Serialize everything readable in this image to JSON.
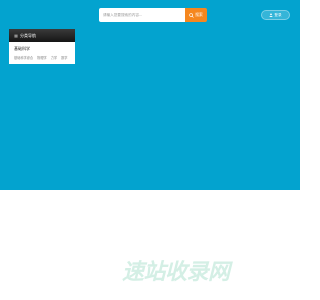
{
  "search": {
    "placeholder": "请输入您要搜索的内容...",
    "button_label": "搜索"
  },
  "header": {
    "login_label": "登录",
    "accent_color": "#03a3cf",
    "button_color": "#f5871f"
  },
  "category_panel": {
    "header": "分类导航",
    "title": "基础科学",
    "links": [
      "基础科学综合",
      "物理学",
      "力学",
      "数学"
    ]
  },
  "watermark": {
    "text": "速站收录网"
  }
}
